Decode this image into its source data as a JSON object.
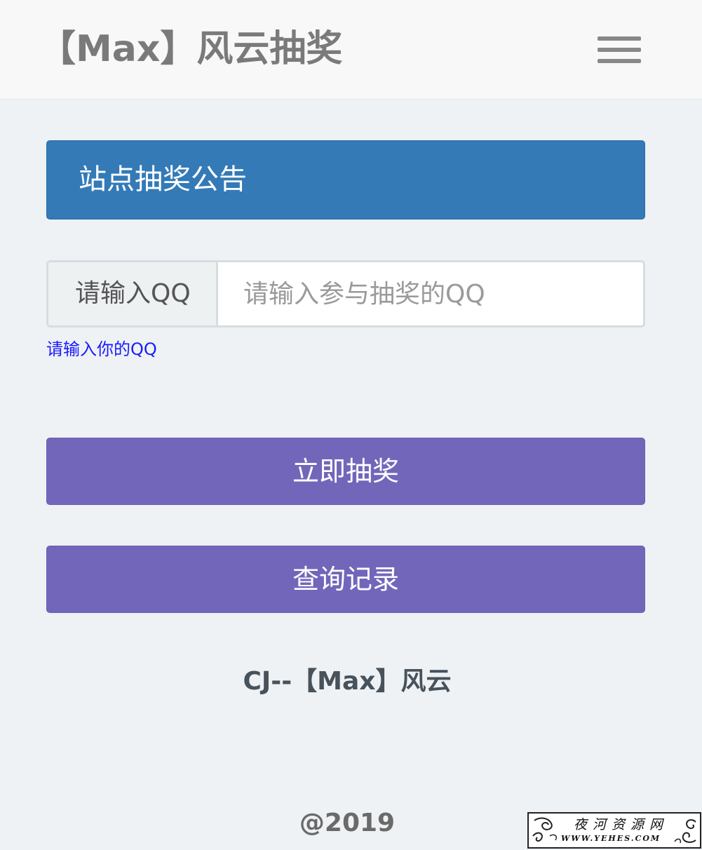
{
  "navbar": {
    "brand": "【Max】风云抽奖",
    "menu_icon": "hamburger-menu-icon"
  },
  "notice": {
    "title": "站点抽奖公告",
    "color": "#337ab7"
  },
  "qq_form": {
    "addon_label": "请输入QQ",
    "input_value": "",
    "input_placeholder": "请输入参与抽奖的QQ",
    "help_text": "请输入你的QQ"
  },
  "actions": {
    "draw_label": "立即抽奖",
    "query_label": "查询记录",
    "button_color": "#7266ba"
  },
  "footer": {
    "sign": "CJ--【Max】风云",
    "year": "@2019"
  },
  "watermark": {
    "cn": "夜河资源网",
    "en": "WWW.YEHES.COM"
  }
}
